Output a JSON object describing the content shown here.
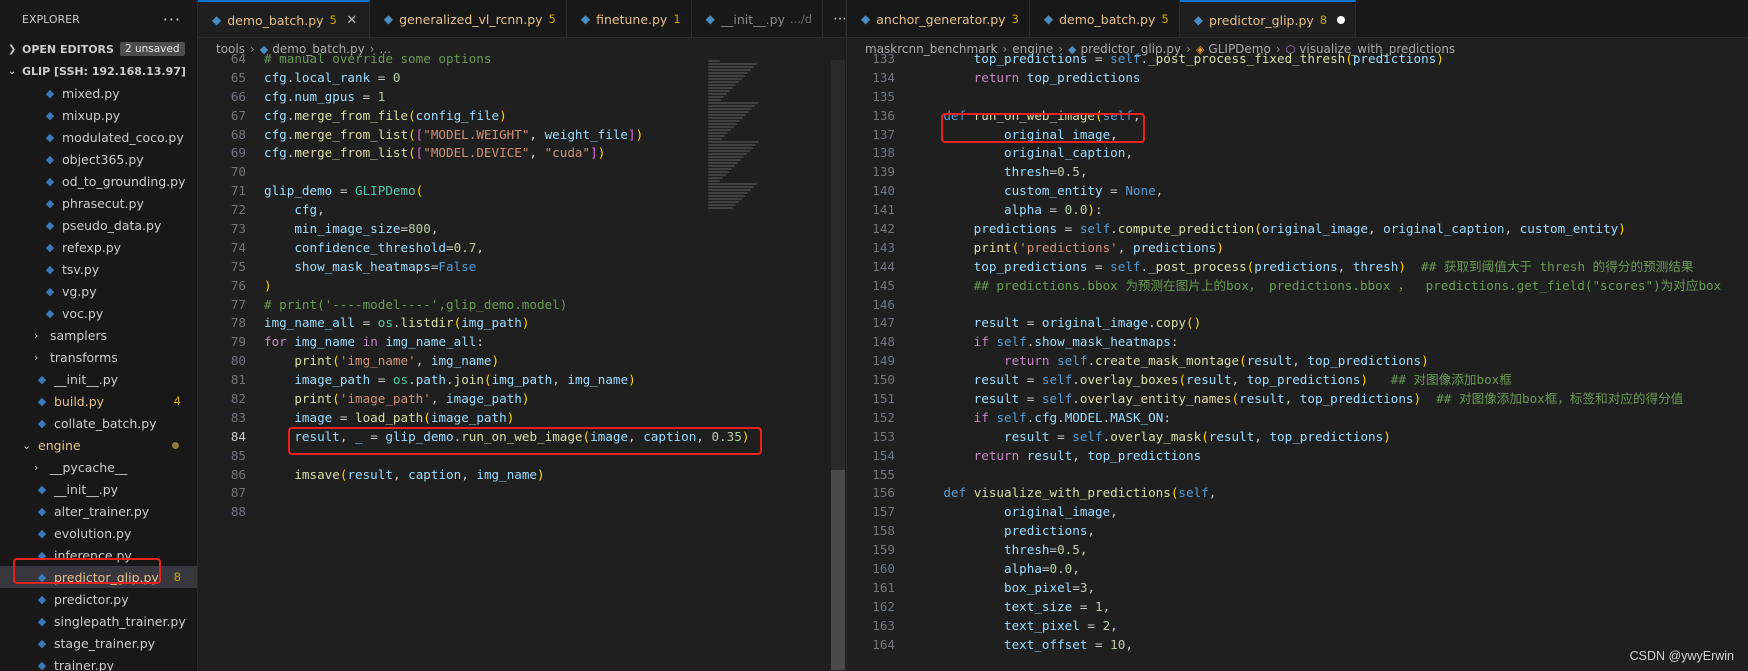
{
  "sidebar": {
    "title": "EXPLORER",
    "more": "···",
    "open_editors": {
      "label": "OPEN EDITORS",
      "badge": "2 unsaved"
    },
    "workspace": {
      "label": "GLIP [SSH: 192.168.13.97]"
    },
    "items": [
      {
        "label": "mixed.py",
        "kind": "py",
        "indent": 1
      },
      {
        "label": "mixup.py",
        "kind": "py",
        "indent": 1
      },
      {
        "label": "modulated_coco.py",
        "kind": "py",
        "indent": 1
      },
      {
        "label": "object365.py",
        "kind": "py",
        "indent": 1
      },
      {
        "label": "od_to_grounding.py",
        "kind": "py",
        "indent": 1
      },
      {
        "label": "phrasecut.py",
        "kind": "py",
        "indent": 1
      },
      {
        "label": "pseudo_data.py",
        "kind": "py",
        "indent": 1
      },
      {
        "label": "refexp.py",
        "kind": "py",
        "indent": 1
      },
      {
        "label": "tsv.py",
        "kind": "py",
        "indent": 1
      },
      {
        "label": "vg.py",
        "kind": "py",
        "indent": 1
      },
      {
        "label": "voc.py",
        "kind": "py",
        "indent": 1
      },
      {
        "label": "samplers",
        "kind": "folder",
        "indent": 0
      },
      {
        "label": "transforms",
        "kind": "folder",
        "indent": 0
      },
      {
        "label": "__init__.py",
        "kind": "py",
        "indent": 0
      },
      {
        "label": "build.py",
        "kind": "py",
        "indent": 0,
        "count": "4",
        "modified": true
      },
      {
        "label": "collate_batch.py",
        "kind": "py",
        "indent": 0
      },
      {
        "label": "engine",
        "kind": "folder-open",
        "indent": -1,
        "modified": true
      },
      {
        "label": "__pycache__",
        "kind": "folder",
        "indent": 0
      },
      {
        "label": "__init__.py",
        "kind": "py",
        "indent": 0
      },
      {
        "label": "alter_trainer.py",
        "kind": "py",
        "indent": 0
      },
      {
        "label": "evolution.py",
        "kind": "py",
        "indent": 0
      },
      {
        "label": "inference.py",
        "kind": "py",
        "indent": 0
      },
      {
        "label": "predictor_glip.py",
        "kind": "py",
        "indent": 0,
        "count": "8",
        "modified": true,
        "selected": true
      },
      {
        "label": "predictor.py",
        "kind": "py",
        "indent": 0
      },
      {
        "label": "singlepath_trainer.py",
        "kind": "py",
        "indent": 0
      },
      {
        "label": "stage_trainer.py",
        "kind": "py",
        "indent": 0
      },
      {
        "label": "trainer.py",
        "kind": "py",
        "indent": 0
      }
    ]
  },
  "left_editor": {
    "tabs": [
      {
        "label": "demo_batch.py",
        "count": "5",
        "active": true,
        "close": "✕"
      },
      {
        "label": "generalized_vl_rcnn.py",
        "count": "5"
      },
      {
        "label": "finetune.py",
        "count": "1"
      },
      {
        "label": "__init__.py",
        "sub": ".../d",
        "dim": true
      }
    ],
    "actions": [
      "⋯"
    ],
    "breadcrumb": [
      "tools",
      "demo_batch.py",
      "..."
    ],
    "lines": [
      {
        "n": "64",
        "html": "<span class=\"cm\"># manual override some options</span>"
      },
      {
        "n": "65",
        "html": "<span class=\"var\">cfg</span>.<span class=\"var\">local_rank</span> = <span class=\"num\">0</span>"
      },
      {
        "n": "66",
        "html": "<span class=\"var\">cfg</span>.<span class=\"var\">num_gpus</span> = <span class=\"num\">1</span>"
      },
      {
        "n": "67",
        "html": "<span class=\"var\">cfg</span>.<span class=\"fn\">merge_from_file</span><span class=\"br1\">(</span><span class=\"var\">config_file</span><span class=\"br1\">)</span>"
      },
      {
        "n": "68",
        "html": "<span class=\"var\">cfg</span>.<span class=\"fn\">merge_from_list</span><span class=\"br1\">(</span><span class=\"br2\">[</span><span class=\"str\">\"MODEL.WEIGHT\"</span>, <span class=\"var\">weight_file</span><span class=\"br2\">]</span><span class=\"br1\">)</span>"
      },
      {
        "n": "69",
        "html": "<span class=\"var\">cfg</span>.<span class=\"fn\">merge_from_list</span><span class=\"br1\">(</span><span class=\"br2\">[</span><span class=\"str\">\"MODEL.DEVICE\"</span>, <span class=\"str\">\"cuda\"</span><span class=\"br2\">]</span><span class=\"br1\">)</span>"
      },
      {
        "n": "70",
        "html": ""
      },
      {
        "n": "71",
        "html": "<span class=\"var\">glip_demo</span> = <span class=\"cls\">GLIPDemo</span><span class=\"br1\">(</span>"
      },
      {
        "n": "72",
        "html": "    <span class=\"var\">cfg</span>,"
      },
      {
        "n": "73",
        "html": "    <span class=\"var\">min_image_size</span>=<span class=\"num\">800</span>,"
      },
      {
        "n": "74",
        "html": "    <span class=\"var\">confidence_threshold</span>=<span class=\"num\">0.7</span>,"
      },
      {
        "n": "75",
        "html": "    <span class=\"var\">show_mask_heatmaps</span>=<span class=\"kw\">False</span>"
      },
      {
        "n": "76",
        "html": "<span class=\"br1\">)</span>"
      },
      {
        "n": "77",
        "html": "<span class=\"cm\"># print('----model----',glip_demo.model)</span>"
      },
      {
        "n": "78",
        "html": "<span class=\"var\">img_name_all</span> = <span class=\"cls\">os</span>.<span class=\"fn\">listdir</span><span class=\"br1\">(</span><span class=\"var\">img_path</span><span class=\"br1\">)</span>"
      },
      {
        "n": "79",
        "html": "<span class=\"kw2\">for</span> <span class=\"var\">img_name</span> <span class=\"kw2\">in</span> <span class=\"var\">img_name_all</span>:"
      },
      {
        "n": "80",
        "html": "    <span class=\"fn\">print</span><span class=\"br1\">(</span><span class=\"str\">'img_name'</span>, <span class=\"var\">img_name</span><span class=\"br1\">)</span>"
      },
      {
        "n": "81",
        "html": "    <span class=\"var\">image_path</span> = <span class=\"cls\">os</span>.<span class=\"var\">path</span>.<span class=\"fn\">join</span><span class=\"br1\">(</span><span class=\"var\">img_path</span>, <span class=\"var\">img_name</span><span class=\"br1\">)</span>"
      },
      {
        "n": "82",
        "html": "    <span class=\"fn\">print</span><span class=\"br1\">(</span><span class=\"str\">'image_path'</span>, <span class=\"var\">image_path</span><span class=\"br1\">)</span>"
      },
      {
        "n": "83",
        "html": "    <span class=\"var\">image</span> = <span class=\"fn\">load_path</span><span class=\"br1\">(</span><span class=\"var\">image_path</span><span class=\"br1\">)</span>"
      },
      {
        "n": "84",
        "html": "    <span class=\"var\">result</span>, <span class=\"var\">_</span> = <span class=\"var\">glip_demo</span>.<span class=\"fn\">run_on_web_image</span><span class=\"br1\">(</span><span class=\"var\">image</span>, <span class=\"var\">caption</span>, <span class=\"num\">0.35</span><span class=\"br1\">)</span>",
        "current": true
      },
      {
        "n": "85",
        "html": ""
      },
      {
        "n": "86",
        "html": "    <span class=\"fn\">imsave</span><span class=\"br1\">(</span><span class=\"var\">result</span>, <span class=\"var\">caption</span>, <span class=\"var\">img_name</span><span class=\"br1\">)</span>"
      },
      {
        "n": "87",
        "html": ""
      },
      {
        "n": "88",
        "html": ""
      }
    ]
  },
  "right_editor": {
    "tabs": [
      {
        "label": "anchor_generator.py",
        "count": "3"
      },
      {
        "label": "demo_batch.py",
        "count": "5"
      },
      {
        "label": "predictor_glip.py",
        "count": "8",
        "active": true,
        "dirty": true
      }
    ],
    "breadcrumb": [
      "maskrcnn_benchmark",
      "engine",
      "predictor_glip.py",
      "GLIPDemo",
      "visualize_with_predictions"
    ],
    "lines": [
      {
        "n": "133",
        "html": "        <span class=\"var\">top_predictions</span> = <span class=\"self\">self</span>.<span class=\"fn\">_post_process_fixed_thresh</span><span class=\"br1\">(</span><span class=\"var\">predictions</span><span class=\"br1\">)</span>"
      },
      {
        "n": "134",
        "html": "        <span class=\"kw2\">return</span> <span class=\"var\">top_predictions</span>"
      },
      {
        "n": "135",
        "html": ""
      },
      {
        "n": "136",
        "html": "    <span class=\"kw\">def</span> <span class=\"fn\">run_on_web_image</span><span class=\"br1\">(</span><span class=\"self\">self</span>,"
      },
      {
        "n": "137",
        "html": "            <span class=\"var\">original_image</span>,"
      },
      {
        "n": "138",
        "html": "            <span class=\"var\">original_caption</span>,"
      },
      {
        "n": "139",
        "html": "            <span class=\"var\">thresh</span>=<span class=\"num\">0.5</span>,"
      },
      {
        "n": "140",
        "html": "            <span class=\"var\">custom_entity</span> = <span class=\"kw\">None</span>,"
      },
      {
        "n": "141",
        "html": "            <span class=\"var\">alpha</span> = <span class=\"num\">0.0</span><span class=\"br1\">)</span>:"
      },
      {
        "n": "142",
        "html": "        <span class=\"var\">predictions</span> = <span class=\"self\">self</span>.<span class=\"fn\">compute_prediction</span><span class=\"br1\">(</span><span class=\"var\">original_image</span>, <span class=\"var\">original_caption</span>, <span class=\"var\">custom_entity</span><span class=\"br1\">)</span>"
      },
      {
        "n": "143",
        "html": "        <span class=\"fn\">print</span><span class=\"br1\">(</span><span class=\"str\">'predictions'</span>, <span class=\"var\">predictions</span><span class=\"br1\">)</span>"
      },
      {
        "n": "144",
        "html": "        <span class=\"var\">top_predictions</span> = <span class=\"self\">self</span>.<span class=\"fn\">_post_process</span><span class=\"br1\">(</span><span class=\"var\">predictions</span>, <span class=\"var\">thresh</span><span class=\"br1\">)</span>  <span class=\"cm\">## 获取到阈值大于 thresh 的得分的预测结果</span>"
      },
      {
        "n": "145",
        "html": "        <span class=\"cm\">## predictions.bbox 为预测在图片上的box， predictions.bbox ，  predictions.get_field(\"scores\")为对应box</span>"
      },
      {
        "n": "146",
        "html": ""
      },
      {
        "n": "147",
        "html": "        <span class=\"var\">result</span> = <span class=\"var\">original_image</span>.<span class=\"fn\">copy</span><span class=\"br1\">()</span>"
      },
      {
        "n": "148",
        "html": "        <span class=\"kw2\">if</span> <span class=\"self\">self</span>.<span class=\"var\">show_mask_heatmaps</span>:"
      },
      {
        "n": "149",
        "html": "            <span class=\"kw2\">return</span> <span class=\"self\">self</span>.<span class=\"fn\">create_mask_montage</span><span class=\"br1\">(</span><span class=\"var\">result</span>, <span class=\"var\">top_predictions</span><span class=\"br1\">)</span>"
      },
      {
        "n": "150",
        "html": "        <span class=\"var\">result</span> = <span class=\"self\">self</span>.<span class=\"fn\">overlay_boxes</span><span class=\"br1\">(</span><span class=\"var\">result</span>, <span class=\"var\">top_predictions</span><span class=\"br1\">)</span>   <span class=\"cm\">## 对图像添加box框</span>"
      },
      {
        "n": "151",
        "html": "        <span class=\"var\">result</span> = <span class=\"self\">self</span>.<span class=\"fn\">overlay_entity_names</span><span class=\"br1\">(</span><span class=\"var\">result</span>, <span class=\"var\">top_predictions</span><span class=\"br1\">)</span>  <span class=\"cm\">## 对图像添加box框，标签和对应的得分值</span>"
      },
      {
        "n": "152",
        "html": "        <span class=\"kw2\">if</span> <span class=\"self\">self</span>.<span class=\"var\">cfg</span>.<span class=\"var\">MODEL</span>.<span class=\"var\">MASK_ON</span>:"
      },
      {
        "n": "153",
        "html": "            <span class=\"var\">result</span> = <span class=\"self\">self</span>.<span class=\"fn\">overlay_mask</span><span class=\"br1\">(</span><span class=\"var\">result</span>, <span class=\"var\">top_predictions</span><span class=\"br1\">)</span>"
      },
      {
        "n": "154",
        "html": "        <span class=\"kw2\">return</span> <span class=\"var\">result</span>, <span class=\"var\">top_predictions</span>"
      },
      {
        "n": "155",
        "html": ""
      },
      {
        "n": "156",
        "html": "    <span class=\"kw\">def</span> <span class=\"fn\">visualize_with_predictions</span><span class=\"br1\">(</span><span class=\"self\">self</span>,"
      },
      {
        "n": "157",
        "html": "            <span class=\"var\">original_image</span>,"
      },
      {
        "n": "158",
        "html": "            <span class=\"var\">predictions</span>,"
      },
      {
        "n": "159",
        "html": "            <span class=\"var\">thresh</span>=<span class=\"num\">0.5</span>,"
      },
      {
        "n": "160",
        "html": "            <span class=\"var\">alpha</span>=<span class=\"num\">0.0</span>,"
      },
      {
        "n": "161",
        "html": "            <span class=\"var\">box_pixel</span>=<span class=\"num\">3</span>,"
      },
      {
        "n": "162",
        "html": "            <span class=\"var\">text_size</span> = <span class=\"num\">1</span>,"
      },
      {
        "n": "163",
        "html": "            <span class=\"var\">text_pixel</span> = <span class=\"num\">2</span>,"
      },
      {
        "n": "164",
        "html": "            <span class=\"var\">text_offset</span> = <span class=\"num\">10</span>,"
      }
    ]
  },
  "watermark": "CSDN @ywyErwin",
  "colors": {
    "highlight": "#e8231f",
    "accent": "#0078d4",
    "modified": "#e2c08d"
  }
}
